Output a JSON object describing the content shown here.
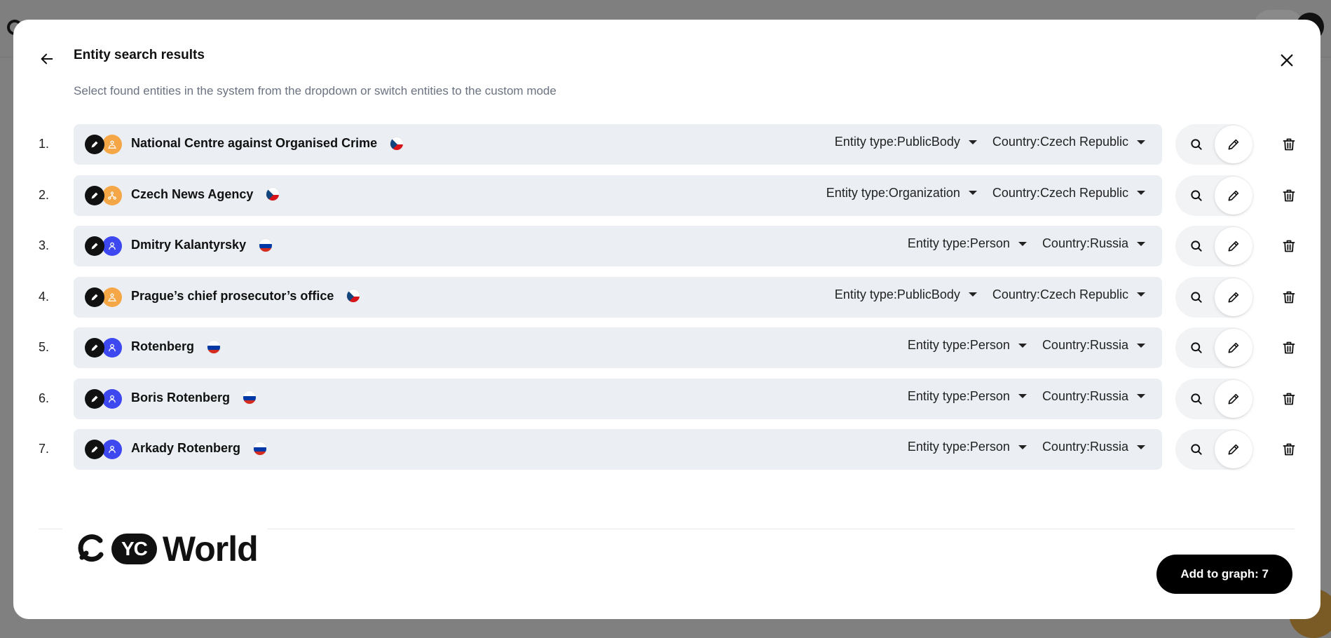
{
  "dialog": {
    "title": "Entity search results",
    "subtitle": "Select found entities in the system from the dropdown or switch entities to the custom mode"
  },
  "entity_type_prefix": "Entity type: ",
  "country_prefix": "Country: ",
  "entities": [
    {
      "index": "1.",
      "name": "National Centre against Organised Crime",
      "entity_type": "PublicBody",
      "country": "Czech Republic",
      "type_icon": "public-body-icon",
      "flag": "czech-flag-icon"
    },
    {
      "index": "2.",
      "name": "Czech News Agency",
      "entity_type": "Organization",
      "country": "Czech Republic",
      "type_icon": "organization-icon",
      "flag": "czech-flag-icon"
    },
    {
      "index": "3.",
      "name": "Dmitry Kalantyrsky",
      "entity_type": "Person",
      "country": "Russia",
      "type_icon": "person-icon",
      "flag": "russia-flag-icon"
    },
    {
      "index": "4.",
      "name": "Prague’s chief prosecutor’s office",
      "entity_type": "PublicBody",
      "country": "Czech Republic",
      "type_icon": "public-body-icon",
      "flag": "czech-flag-icon"
    },
    {
      "index": "5.",
      "name": "Rotenberg",
      "entity_type": "Person",
      "country": "Russia",
      "type_icon": "person-icon",
      "flag": "russia-flag-icon"
    },
    {
      "index": "6.",
      "name": "Boris Rotenberg",
      "entity_type": "Person",
      "country": "Russia",
      "type_icon": "person-icon",
      "flag": "russia-flag-icon"
    },
    {
      "index": "7.",
      "name": "Arkady Rotenberg",
      "entity_type": "Person",
      "country": "Russia",
      "type_icon": "person-icon",
      "flag": "russia-flag-icon"
    }
  ],
  "brand": {
    "yc": "YC",
    "world": "World"
  },
  "footer": {
    "add_button_label": "Add to graph: 7"
  },
  "colors": {
    "row_background": "#ebeff3",
    "public_body_icon": "#f5a748",
    "organization_icon": "#f5a748",
    "person_icon": "#3d48f0",
    "primary_button": "#000000"
  }
}
